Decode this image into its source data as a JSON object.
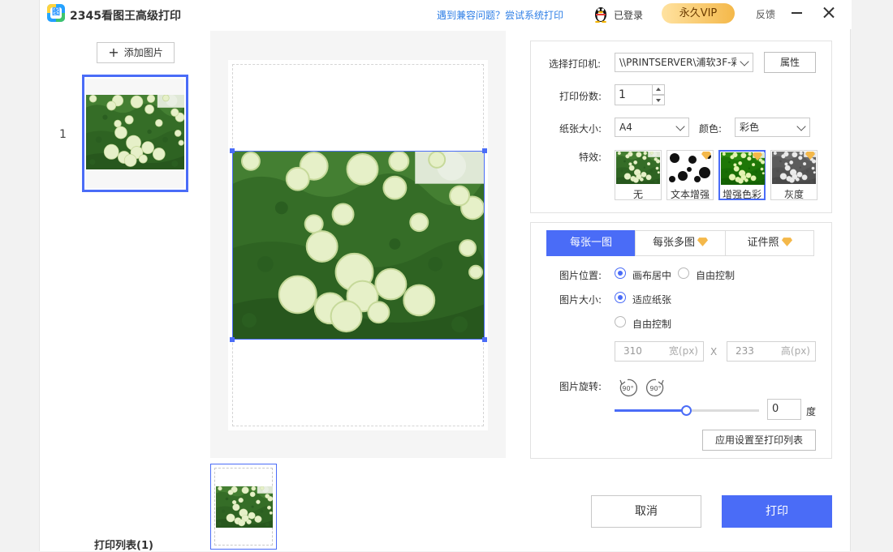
{
  "app": {
    "title": "2345看图王高级打印",
    "compat_link": "遇到兼容问题？尝试系统打印",
    "login_status": "已登录",
    "vip_label": "永久VIP",
    "feedback_label": "反馈"
  },
  "thumbnails": {
    "add_button": "添加图片",
    "first_index": "1",
    "list_title": "打印列表(1)"
  },
  "settings": {
    "printer_label": "选择打印机:",
    "printer_value": "\\\\PRINTSERVER\\浦软3F-彩",
    "properties_button": "属性",
    "copies_label": "打印份数:",
    "copies_value": "1",
    "paper_label": "纸张大小:",
    "paper_value": "A4",
    "color_label": "颜色:",
    "color_value": "彩色",
    "effects_label": "特效:",
    "effects": [
      {
        "label": "无",
        "selected": false,
        "vip": false
      },
      {
        "label": "文本增强",
        "selected": false,
        "vip": true
      },
      {
        "label": "增强色彩",
        "selected": true,
        "vip": true
      },
      {
        "label": "灰度",
        "selected": false,
        "vip": true
      }
    ]
  },
  "layout": {
    "tabs": [
      {
        "label": "每张一图",
        "active": true,
        "vip": false
      },
      {
        "label": "每张多图",
        "active": false,
        "vip": true
      },
      {
        "label": "证件照",
        "active": false,
        "vip": true
      }
    ],
    "position_label": "图片位置:",
    "position_options": [
      "画布居中",
      "自由控制"
    ],
    "position_selected": "画布居中",
    "size_label": "图片大小:",
    "size_options": [
      "适应纸张",
      "自由控制"
    ],
    "size_selected": "适应纸张",
    "width_value": "310",
    "width_unit": "宽(px)",
    "times_sign": "X",
    "height_value": "233",
    "height_unit": "高(px)",
    "rotate_label": "图片旋转:",
    "rotate_left_text": "90°",
    "rotate_right_text": "90°",
    "rotation_slider_fraction": 0.5,
    "angle_value": "0",
    "angle_unit": "度",
    "apply_button": "应用设置至打印列表"
  },
  "actions": {
    "cancel": "取消",
    "print": "打印"
  },
  "colors": {
    "accent": "#4a6cf7",
    "vip_gold": "#f4b84a",
    "link": "#2f7fe6"
  },
  "icons": [
    "app-logo-icon",
    "qq-penguin-icon",
    "minimize-icon",
    "close-icon",
    "plus-icon",
    "vip-diamond-icon",
    "rotate-left-icon",
    "rotate-right-icon"
  ]
}
